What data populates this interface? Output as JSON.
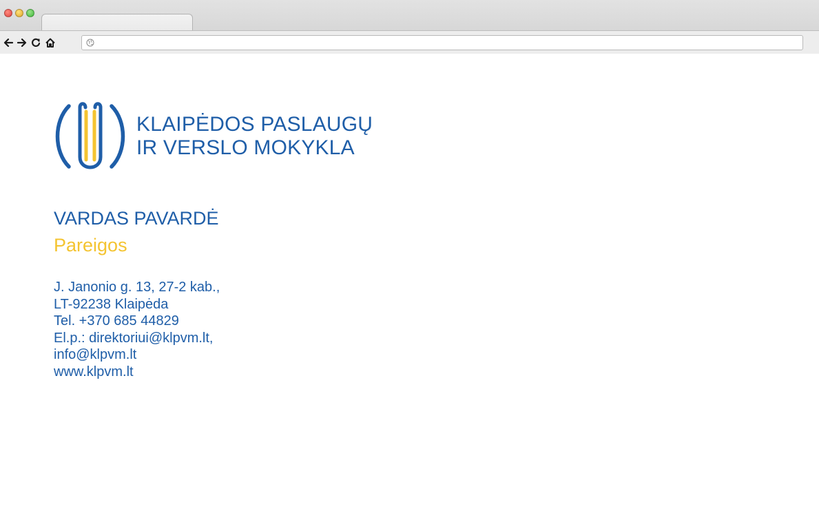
{
  "browser": {
    "tab_title": "",
    "url": "",
    "icons": [
      "back-arrow-icon",
      "forward-arrow-icon",
      "reload-icon",
      "home-icon",
      "globe-icon"
    ]
  },
  "logo": {
    "line1": "KLAIPĖDOS PASLAUGŲ",
    "line2": "IR VERSLO MOKYKLA",
    "colors": {
      "blue": "#1f5ea8",
      "yellow": "#f4c431"
    }
  },
  "person": {
    "name": "VARDAS PAVARDĖ",
    "role": "Pareigos"
  },
  "contact": {
    "address_line1": "J. Janonio g. 13, 27-2 kab.,",
    "address_line2": "LT-92238 Klaipėda",
    "phone": "Tel. +370 685 44829",
    "email_line1": "El.p.: direktoriui@klpvm.lt,",
    "email_line2": "info@klpvm.lt",
    "website": "www.klpvm.lt"
  }
}
